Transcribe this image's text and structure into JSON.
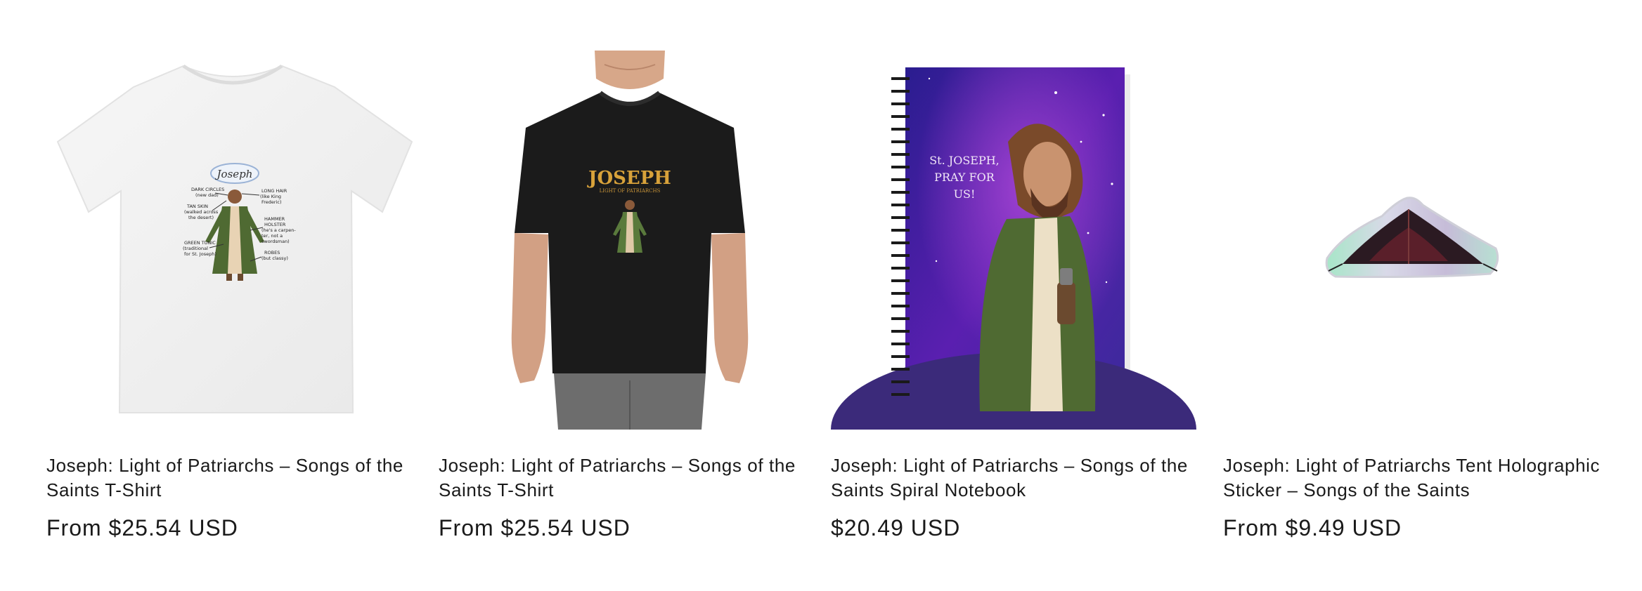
{
  "products": [
    {
      "title": "Joseph: Light of Patriarchs – Songs of the Saints T-Shirt",
      "price": "From $25.54 USD",
      "image_icon": "white-tshirt-product-image",
      "print_title": "Joseph",
      "print_labels": [
        "DARK CIRCLES (new dad)",
        "TAN SKIN (walked across the desert)",
        "GREEN TUNIC (traditional for St. Joseph)",
        "LONG HAIR (like King Frederic)",
        "HAMMER HOLSTER (he's a carpenter, not a swordsman)",
        "ROBES (but classy)"
      ]
    },
    {
      "title": "Joseph: Light of Patriarchs – Songs of the Saints T-Shirt",
      "price": "From $25.54 USD",
      "image_icon": "black-tshirt-model-product-image",
      "print_title": "JOSEPH",
      "print_subtitle": "LIGHT OF PATRIARCHS"
    },
    {
      "title": "Joseph: Light of Patriarchs – Songs of the Saints Spiral Notebook",
      "price": "$20.49 USD",
      "image_icon": "spiral-notebook-product-image",
      "cover_text": [
        "St. JOSEPH,",
        "PRAY FOR",
        "US!"
      ]
    },
    {
      "title": "Joseph: Light of Patriarchs Tent Holographic Sticker – Songs of the Saints",
      "price": "From $9.49 USD",
      "image_icon": "tent-sticker-product-image"
    }
  ],
  "colors": {
    "text": "#1a1a1a",
    "background": "#ffffff",
    "notebook_purple": "#4a1fa8",
    "robe_green": "#4f6a32",
    "gold": "#d8a23a"
  }
}
